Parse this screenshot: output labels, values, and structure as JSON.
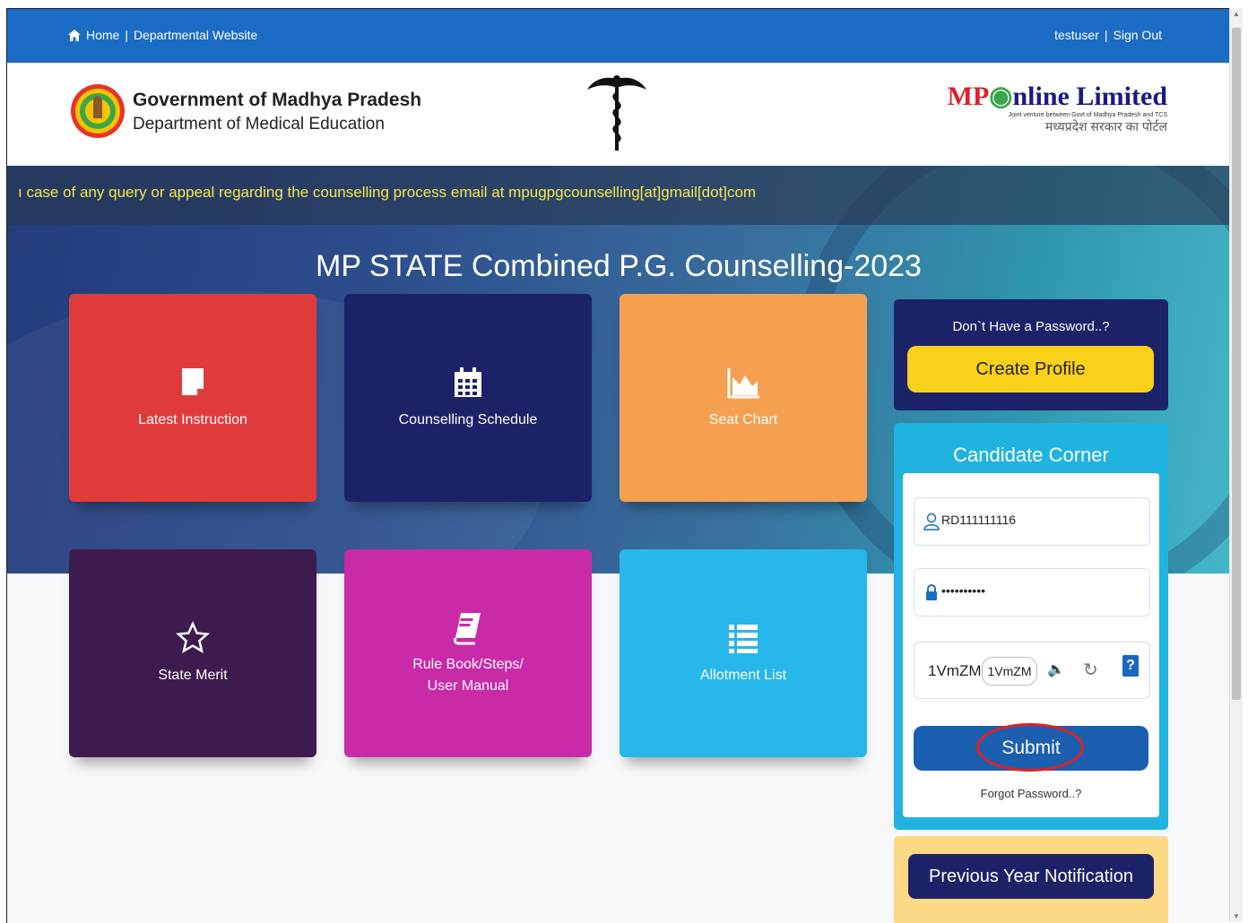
{
  "topbar": {
    "home": "Home",
    "separator": "|",
    "departmental": "Departmental Website",
    "user": "testuser",
    "signout": "Sign Out"
  },
  "header": {
    "gov_title": "Government of Madhya Pradesh",
    "gov_sub": "Department of Medical Education",
    "mponline_mp": "MP",
    "mponline_rest": "nline Limited",
    "mponline_tag": "Joint venture between Govt of Madhya Pradesh and TCS",
    "mponline_hindi": "मध्यप्रदेश सरकार का पोर्टल"
  },
  "marquee": {
    "text": "ı case of any query or appeal regarding the counselling process email at mpugpgcounselling[at]gmail[dot]com"
  },
  "page_title": "MP STATE Combined P.G. Counselling-2023",
  "tiles": [
    {
      "label": "Latest Instruction",
      "icon": "document-icon",
      "color": "#e03b3b"
    },
    {
      "label": "Counselling Schedule",
      "icon": "calendar-icon",
      "color": "#1c2268"
    },
    {
      "label": "Seat Chart",
      "icon": "area-chart-icon",
      "color": "#f5a050"
    },
    {
      "label": "State Merit",
      "icon": "star-icon",
      "color": "#3e1b4e"
    },
    {
      "label": "Rule Book/Steps/",
      "label2": "User Manual",
      "icon": "book-icon",
      "color": "#c82aa8"
    },
    {
      "label": "Allotment List",
      "icon": "list-icon",
      "color": "#27b7ea"
    }
  ],
  "create": {
    "question": "Don`t Have a Password..?",
    "button": "Create Profile"
  },
  "candidate": {
    "title": "Candidate Corner",
    "username": "RD111111116",
    "password": "••••••••••",
    "captcha_code": "1VmZM",
    "captcha_input": "1VmZM",
    "help": "?",
    "submit": "Submit",
    "forgot": "Forgot Password..?"
  },
  "prev": {
    "button": "Previous Year Notification"
  }
}
